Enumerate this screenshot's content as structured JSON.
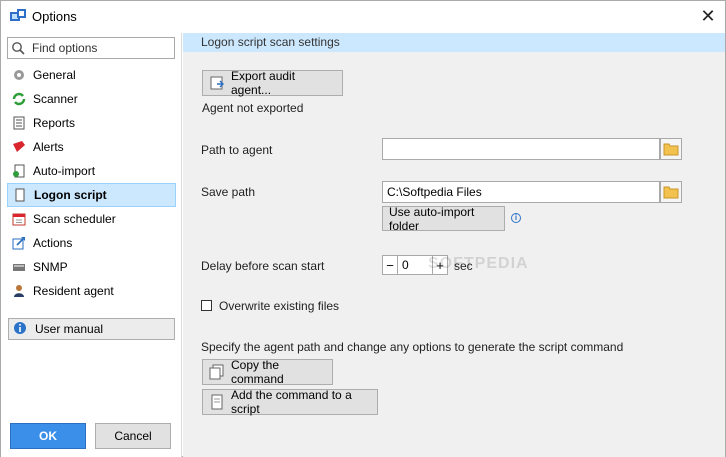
{
  "window": {
    "title": "Options",
    "close_glyph": "✕"
  },
  "sidebar": {
    "search_placeholder": "Find options",
    "items": [
      {
        "label": "General",
        "icon": "gear-icon"
      },
      {
        "label": "Scanner",
        "icon": "scanner-icon"
      },
      {
        "label": "Reports",
        "icon": "report-icon"
      },
      {
        "label": "Alerts",
        "icon": "alert-icon"
      },
      {
        "label": "Auto-import",
        "icon": "auto-import-icon"
      },
      {
        "label": "Logon script",
        "icon": "logon-script-icon",
        "selected": true
      },
      {
        "label": "Scan scheduler",
        "icon": "calendar-icon"
      },
      {
        "label": "Actions",
        "icon": "actions-icon"
      },
      {
        "label": "SNMP",
        "icon": "snmp-icon"
      },
      {
        "label": "Resident agent",
        "icon": "resident-agent-icon"
      }
    ],
    "user_manual": "User manual",
    "ok": "OK",
    "cancel": "Cancel"
  },
  "content": {
    "header": "Logon script scan settings",
    "export_button": "Export audit agent...",
    "export_status": "Agent not exported",
    "path_to_agent_label": "Path to agent",
    "path_to_agent_value": "",
    "save_path_label": "Save path",
    "save_path_value": "C:\\Softpedia Files",
    "use_auto_import": "Use auto-import folder",
    "delay_label": "Delay before scan start",
    "delay_value": "0",
    "delay_unit": "sec",
    "minus": "−",
    "plus": "+",
    "overwrite_label": "Overwrite existing files",
    "overwrite_checked": false,
    "instruction": "Specify the agent path and change any options to generate the script command",
    "copy_command": "Copy the command",
    "add_command": "Add the command to a script",
    "watermark": "SOFTPEDIA"
  },
  "colors": {
    "accent": "#3c8fe8",
    "header_bg": "#cce8ff",
    "selected_border": "#99d1ff",
    "content_bg": "#f0f0f0"
  }
}
